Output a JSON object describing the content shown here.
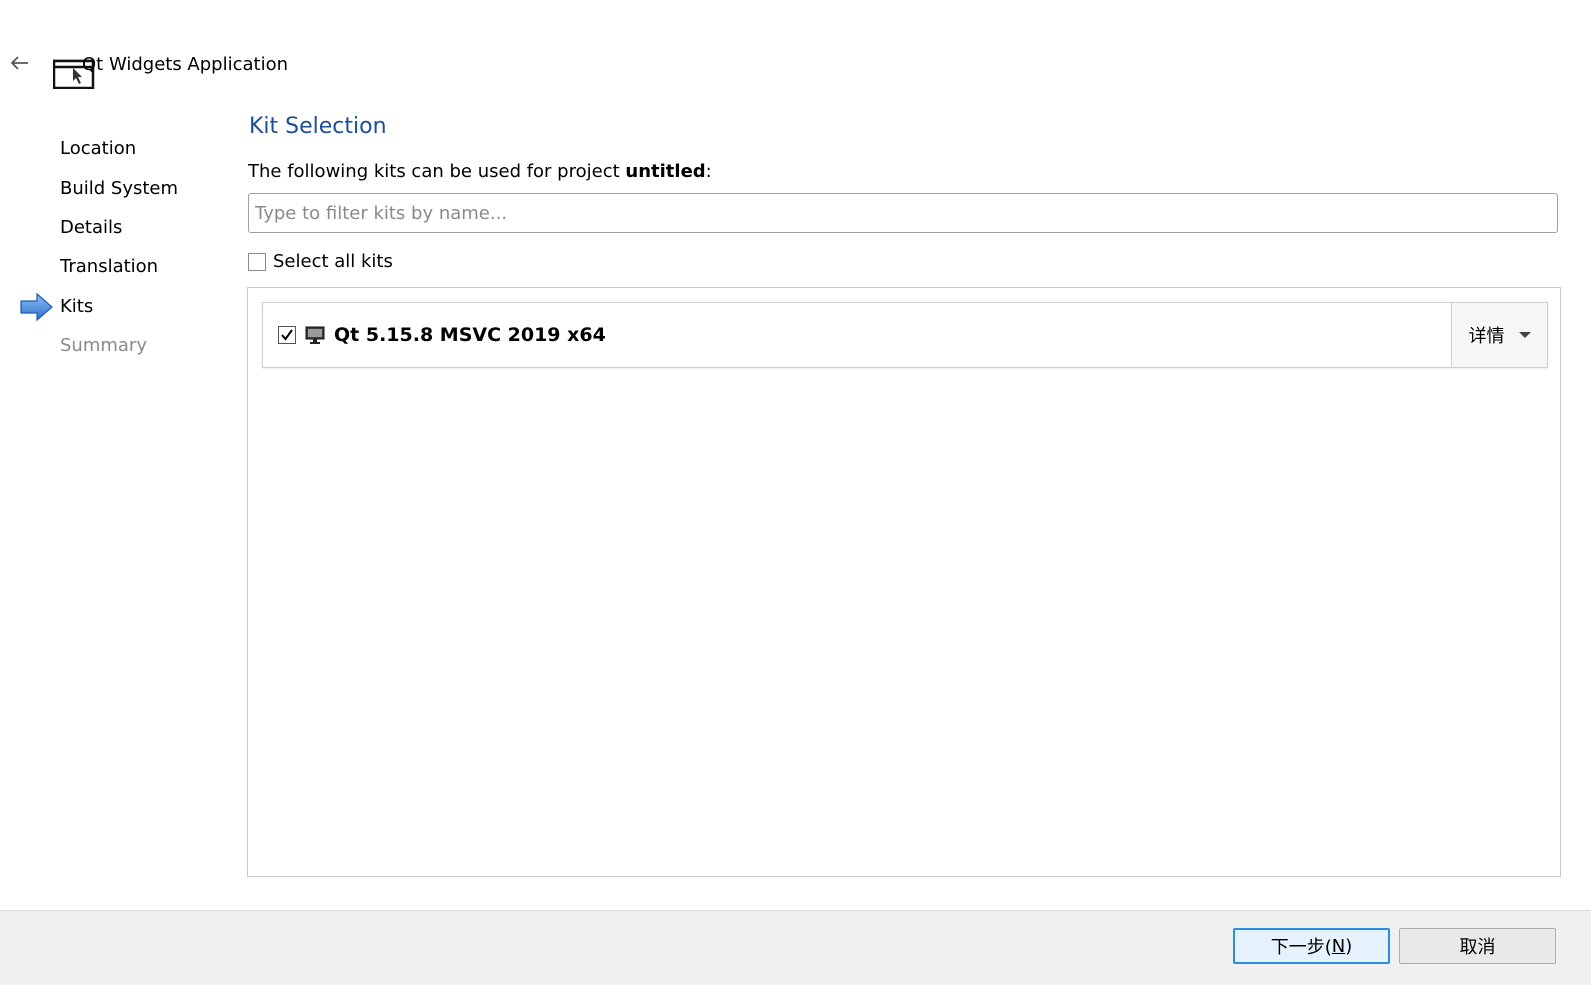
{
  "header": {
    "window_title": "Qt Widgets Application"
  },
  "sidebar": {
    "steps": [
      {
        "label": "Location",
        "state": "done"
      },
      {
        "label": "Build System",
        "state": "done"
      },
      {
        "label": "Details",
        "state": "done"
      },
      {
        "label": "Translation",
        "state": "done"
      },
      {
        "label": "Kits",
        "state": "current"
      },
      {
        "label": "Summary",
        "state": "disabled"
      }
    ],
    "current_marker_color": "#3a7fd5"
  },
  "main": {
    "section_title": "Kit Selection",
    "intro_prefix": "The following kits can be used for project ",
    "project_name": "untitled",
    "intro_suffix": ":",
    "filter": {
      "value": "",
      "placeholder": "Type to filter kits by name..."
    },
    "select_all": {
      "label": "Select all kits",
      "checked": false
    },
    "kits": [
      {
        "name": "Qt 5.15.8 MSVC 2019 x64",
        "checked": true,
        "icon": "desktop-icon",
        "details_label": "详情"
      }
    ]
  },
  "footer": {
    "next_label": "下一步(",
    "next_mnemonic": "N",
    "next_suffix": ")",
    "cancel_label": "取消"
  },
  "colors": {
    "title_blue": "#1d4e9a",
    "focus_blue": "#2d8ce3"
  }
}
